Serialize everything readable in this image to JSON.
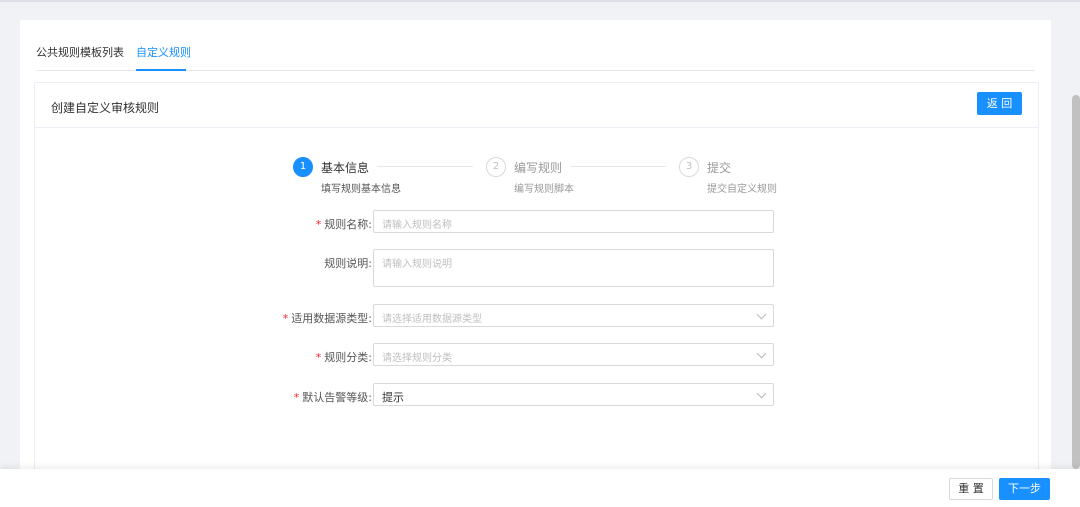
{
  "tabs": [
    {
      "label": "公共规则模板列表"
    },
    {
      "label": "自定义规则"
    }
  ],
  "card": {
    "title": "创建自定义审核规则",
    "back_label": "返 回"
  },
  "steps": [
    {
      "number": "1",
      "title": "基本信息",
      "desc": "填写规则基本信息",
      "status": "active"
    },
    {
      "number": "2",
      "title": "编写规则",
      "desc": "编写规则脚本",
      "status": "wait"
    },
    {
      "number": "3",
      "title": "提交",
      "desc": "提交自定义规则",
      "status": "wait"
    }
  ],
  "form": {
    "rule_name": {
      "label": "规则名称:",
      "required": true,
      "placeholder": "请输入规则名称",
      "value": ""
    },
    "rule_desc": {
      "label": "规则说明:",
      "required": false,
      "placeholder": "请输入规则说明",
      "value": ""
    },
    "datasource_type": {
      "label": "适用数据源类型:",
      "required": true,
      "placeholder": "请选择适用数据源类型",
      "value": ""
    },
    "rule_category": {
      "label": "规则分类:",
      "required": true,
      "placeholder": "请选择规则分类",
      "value": ""
    },
    "alert_level": {
      "label": "默认告警等级:",
      "required": true,
      "placeholder": "",
      "value": "提示"
    }
  },
  "footer": {
    "reset_label": "重 置",
    "next_label": "下一步"
  },
  "colors": {
    "primary": "#1890ff",
    "required": "#f5222d",
    "background": "#f0f2f5"
  }
}
